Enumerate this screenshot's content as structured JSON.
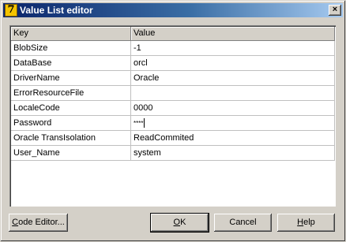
{
  "window": {
    "title": "Value List editor",
    "app_icon_glyph": "7",
    "close_glyph": "×"
  },
  "grid": {
    "headers": [
      "Key",
      "Value"
    ],
    "rows": [
      {
        "key": "BlobSize",
        "value": "-1"
      },
      {
        "key": "DataBase",
        "value": "orcl"
      },
      {
        "key": "DriverName",
        "value": "Oracle"
      },
      {
        "key": "ErrorResourceFile",
        "value": ""
      },
      {
        "key": "LocaleCode",
        "value": "0000"
      },
      {
        "key": "Password",
        "value": "****"
      },
      {
        "key": "Oracle TransIsolation",
        "value": "ReadCommited"
      },
      {
        "key": "User_Name",
        "value": "system"
      }
    ]
  },
  "buttons": {
    "code_editor": {
      "mnemonic": "C",
      "rest": "ode Editor..."
    },
    "ok": {
      "mnemonic": "O",
      "rest": "K"
    },
    "cancel": {
      "label": "Cancel"
    },
    "help": {
      "mnemonic": "H",
      "rest": "elp"
    }
  }
}
